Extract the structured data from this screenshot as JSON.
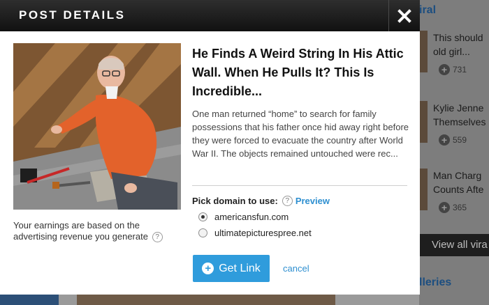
{
  "background": {
    "sidebar_heading": "iral",
    "items": [
      {
        "title_line1": "This should",
        "title_line2": "old girl...",
        "count": "731"
      },
      {
        "title_line1": "Kylie Jenne",
        "title_line2": "Themselves",
        "count": "559"
      },
      {
        "title_line1": "Man Charg",
        "title_line2": "Counts Afte",
        "count": "365"
      }
    ],
    "view_all": "View all vira",
    "galleries": "lleries"
  },
  "modal": {
    "title": "POST DETAILS",
    "post": {
      "title": "He Finds A Weird String In His Attic Wall. When He Pulls It? This Is Incredible...",
      "excerpt": "One man returned “home” to search for family possessions that his father once hid away right before they were forced to evacuate the country after World War II. The objects remained untouched were rec..."
    },
    "earnings_text": "Your earnings are based on the advertising revenue you generate",
    "domain_label": "Pick domain to use:",
    "preview_label": "Preview",
    "domains": [
      {
        "name": "americansfun.com",
        "selected": true
      },
      {
        "name": "ultimatepicturespree.net",
        "selected": false
      }
    ],
    "get_link_label": "Get Link",
    "cancel_label": "cancel"
  },
  "colors": {
    "accent": "#2f9cdc",
    "header": "#1b1b1b",
    "link": "#2e8fd0"
  }
}
